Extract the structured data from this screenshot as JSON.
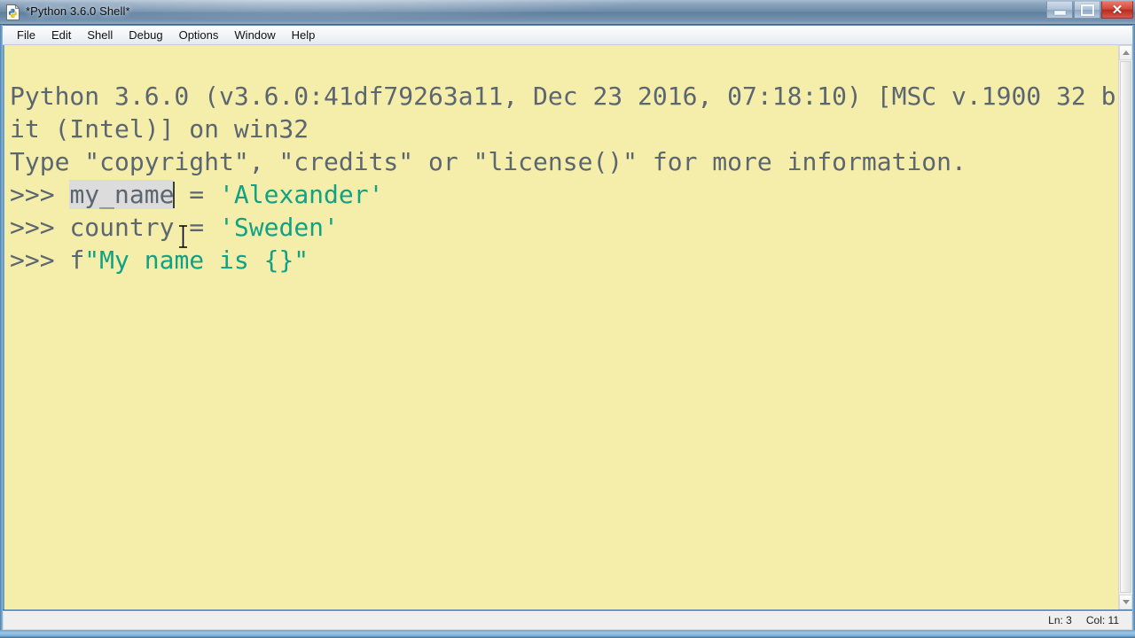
{
  "window": {
    "title": "*Python 3.6.0 Shell*",
    "icon": "python-idle-icon",
    "controls": {
      "minimize": "minimize-button",
      "maximize": "maximize-button",
      "close": "✕"
    },
    "colors": {
      "shell_background": "#f5eeaa",
      "shell_text": "#5b6670",
      "string_literal": "#11a184",
      "name_highlight": "#dcdcdc",
      "titlebar": "#6e8ca9",
      "close_button": "#d24a3c"
    }
  },
  "menubar": {
    "items": [
      {
        "label": "File"
      },
      {
        "label": "Edit"
      },
      {
        "label": "Shell"
      },
      {
        "label": "Debug"
      },
      {
        "label": "Options"
      },
      {
        "label": "Window"
      },
      {
        "label": "Help"
      }
    ]
  },
  "shell": {
    "banner": {
      "line1": "Python 3.6.0 (v3.6.0:41df79263a11, Dec 23 2016, 07:18:10) [MSC v.1900 32 bit (Intel)] on win32",
      "line2": "Type \"copyright\", \"credits\" or \"license()\" for more information."
    },
    "prompt": ">>> ",
    "lines": [
      {
        "prompt": ">>> ",
        "name": "my_name",
        "operator": " = ",
        "value": "'Alexander'"
      },
      {
        "prompt": ">>> ",
        "name": "country",
        "operator": " = ",
        "value": "'Sweden'"
      },
      {
        "prompt": ">>> ",
        "prefix": "f",
        "value": "\"My name is {}\""
      }
    ]
  },
  "statusbar": {
    "line": "Ln: 3",
    "column": "Col: 11"
  },
  "scrollbar": {
    "up_arrow": "scroll-up-arrow",
    "down_arrow": "scroll-down-arrow"
  }
}
